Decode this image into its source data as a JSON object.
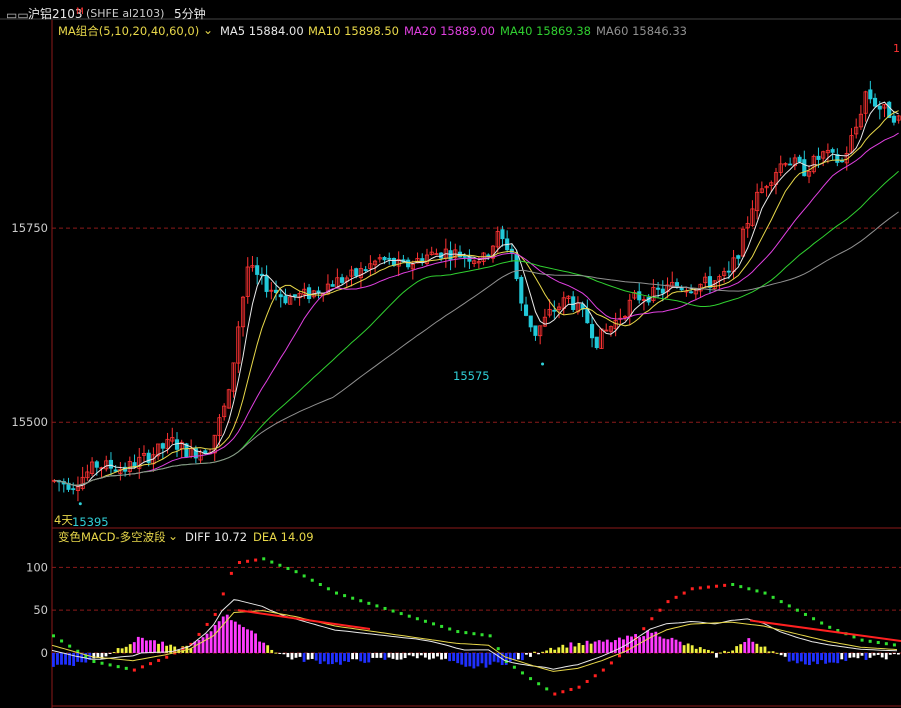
{
  "header": {
    "chart_icon": "chart-type-icon",
    "symbol": "沪铝2103",
    "superscript": "M",
    "code": "(SHFE al2103)",
    "period": "5分钟"
  },
  "ma_legend": {
    "name": "MA组合(5,10,20,40,60,0)",
    "items": [
      {
        "label": "MA5 15884.00",
        "color": "#e8e8e8"
      },
      {
        "label": "MA10 15898.50",
        "color": "#e8d84a"
      },
      {
        "label": "MA20 15889.00",
        "color": "#e040e0"
      },
      {
        "label": "MA40 15869.38",
        "color": "#30d030"
      },
      {
        "label": "MA60 15846.33",
        "color": "#909090"
      }
    ]
  },
  "macd_legend": {
    "name": "变色MACD-多空波段",
    "items": [
      {
        "label": "DIFF 10.72",
        "color": "#e8e8e8"
      },
      {
        "label": "DEA 14.09",
        "color": "#e8d84a"
      }
    ]
  },
  "annotations": {
    "low_label": "15575",
    "left_low_label": "15395",
    "days_label": "4天",
    "right_edge_label": "1"
  },
  "colors": {
    "up": "#ff3333",
    "down": "#22c8d8",
    "grid": "#8b1a1a",
    "axis_text": "#cccccc",
    "accent_cyan": "#30d0d8"
  },
  "chart_data": [
    {
      "type": "candlestick",
      "title": "沪铝2103 5分钟",
      "y_ticks": [
        15500,
        15750
      ],
      "ylim": [
        15365,
        15995
      ],
      "bars": 180,
      "price_path": [
        [
          0,
          15425
        ],
        [
          5,
          15420
        ],
        [
          10,
          15445
        ],
        [
          16,
          15440
        ],
        [
          22,
          15460
        ],
        [
          26,
          15475
        ],
        [
          30,
          15460
        ],
        [
          34,
          15468
        ],
        [
          38,
          15535
        ],
        [
          40,
          15625
        ],
        [
          42,
          15700
        ],
        [
          45,
          15680
        ],
        [
          50,
          15660
        ],
        [
          55,
          15665
        ],
        [
          60,
          15680
        ],
        [
          65,
          15690
        ],
        [
          70,
          15710
        ],
        [
          75,
          15700
        ],
        [
          80,
          15715
        ],
        [
          84,
          15720
        ],
        [
          88,
          15715
        ],
        [
          92,
          15710
        ],
        [
          95,
          15740
        ],
        [
          98,
          15720
        ],
        [
          100,
          15650
        ],
        [
          103,
          15615
        ],
        [
          106,
          15640
        ],
        [
          110,
          15660
        ],
        [
          114,
          15630
        ],
        [
          116,
          15605
        ],
        [
          120,
          15630
        ],
        [
          124,
          15660
        ],
        [
          128,
          15665
        ],
        [
          132,
          15675
        ],
        [
          136,
          15675
        ],
        [
          140,
          15680
        ],
        [
          144,
          15690
        ],
        [
          146,
          15720
        ],
        [
          149,
          15780
        ],
        [
          152,
          15810
        ],
        [
          156,
          15840
        ],
        [
          160,
          15825
        ],
        [
          164,
          15845
        ],
        [
          168,
          15835
        ],
        [
          171,
          15880
        ],
        [
          173,
          15925
        ],
        [
          176,
          15905
        ],
        [
          179,
          15895
        ],
        [
          180,
          15890
        ]
      ],
      "ma_series": [
        {
          "name": "MA5",
          "color": "#e8e8e8",
          "period": 5
        },
        {
          "name": "MA10",
          "color": "#e8d84a",
          "period": 10
        },
        {
          "name": "MA20",
          "color": "#e040e0",
          "period": 20
        },
        {
          "name": "MA40",
          "color": "#30d030",
          "period": 40
        },
        {
          "name": "MA60",
          "color": "#909090",
          "period": 60
        }
      ],
      "annotations": [
        {
          "label": "15575",
          "x": 104,
          "y": 15575
        },
        {
          "label": "15395",
          "x": 6,
          "y": 15395
        }
      ]
    },
    {
      "type": "bar",
      "title": "变色MACD-多空波段",
      "y_ticks": [
        0,
        50,
        100
      ],
      "ylim": [
        -62,
        125
      ],
      "hist_path": [
        [
          0,
          -15
        ],
        [
          6,
          -12
        ],
        [
          12,
          -5
        ],
        [
          18,
          10
        ],
        [
          22,
          18
        ],
        [
          26,
          12
        ],
        [
          30,
          5
        ],
        [
          34,
          8
        ],
        [
          38,
          20
        ],
        [
          42,
          45
        ],
        [
          46,
          35
        ],
        [
          50,
          20
        ],
        [
          54,
          5
        ],
        [
          58,
          -5
        ],
        [
          62,
          -8
        ],
        [
          66,
          -10
        ],
        [
          70,
          -12
        ],
        [
          74,
          -10
        ],
        [
          80,
          -8
        ],
        [
          86,
          -6
        ],
        [
          90,
          -4
        ],
        [
          94,
          -5
        ],
        [
          98,
          -10
        ],
        [
          102,
          -18
        ],
        [
          106,
          -15
        ],
        [
          110,
          -12
        ],
        [
          114,
          -10
        ],
        [
          118,
          -3
        ],
        [
          122,
          5
        ],
        [
          128,
          10
        ],
        [
          134,
          12
        ],
        [
          140,
          15
        ],
        [
          144,
          20
        ],
        [
          148,
          25
        ],
        [
          152,
          18
        ],
        [
          156,
          10
        ],
        [
          160,
          5
        ],
        [
          164,
          -3
        ],
        [
          168,
          5
        ],
        [
          172,
          15
        ],
        [
          176,
          8
        ],
        [
          180,
          -5
        ],
        [
          184,
          -10
        ],
        [
          188,
          -12
        ],
        [
          192,
          -10
        ],
        [
          196,
          -8
        ],
        [
          200,
          -6
        ],
        [
          205,
          -5
        ],
        [
          210,
          -3
        ]
      ],
      "dea_path": [
        [
          0,
          20
        ],
        [
          10,
          -10
        ],
        [
          20,
          -20
        ],
        [
          28,
          -5
        ],
        [
          34,
          10
        ],
        [
          40,
          45
        ],
        [
          45,
          105
        ],
        [
          52,
          110
        ],
        [
          60,
          95
        ],
        [
          70,
          70
        ],
        [
          80,
          55
        ],
        [
          90,
          40
        ],
        [
          100,
          25
        ],
        [
          108,
          20
        ],
        [
          112,
          -10
        ],
        [
          118,
          -30
        ],
        [
          124,
          -48
        ],
        [
          130,
          -40
        ],
        [
          136,
          -20
        ],
        [
          142,
          5
        ],
        [
          148,
          40
        ],
        [
          152,
          60
        ],
        [
          158,
          75
        ],
        [
          168,
          80
        ],
        [
          176,
          70
        ],
        [
          184,
          50
        ],
        [
          192,
          30
        ],
        [
          200,
          15
        ],
        [
          210,
          8
        ]
      ]
    }
  ]
}
